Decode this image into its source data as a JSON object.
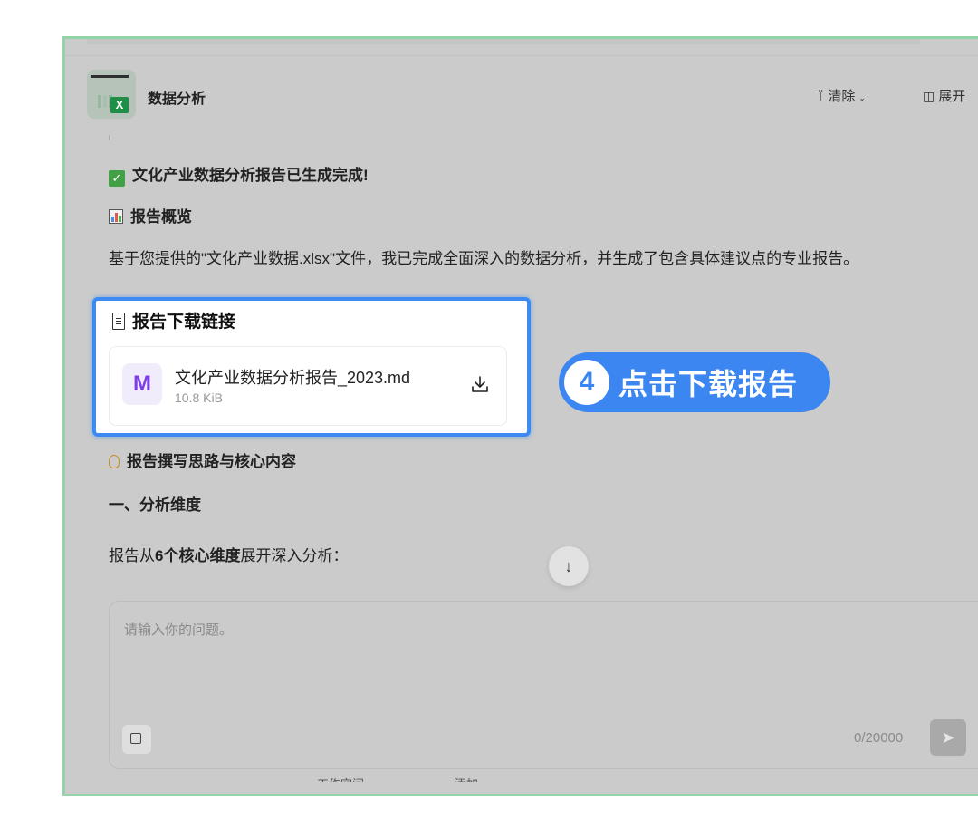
{
  "header": {
    "app_title": "数据分析",
    "clear_label": "清除",
    "expand_label": "展开"
  },
  "chat": {
    "done_title": "文化产业数据分析报告已生成完成!",
    "overview_title": "报告概览",
    "overview_text": "基于您提供的\"文化产业数据.xlsx\"文件，我已完成全面深入的数据分析，并生成了包含具体建议点的专业报告。",
    "download_title": "报告下载链接",
    "file": {
      "icon_letter": "M",
      "name": "文化产业数据分析报告_2023.md",
      "size": "10.8 KiB"
    },
    "idea_title": "报告撰写思路与核心内容",
    "dimension_title": "一、分析维度",
    "dimension_text_pre": "报告从",
    "dimension_text_bold": "6个核心维度",
    "dimension_text_post": "展开深入分析："
  },
  "callout": {
    "step_number": "4",
    "text": "点击下载报告",
    "color": "#3b86f0"
  },
  "input": {
    "placeholder": "请输入你的问题。",
    "char_count": "0/20000"
  },
  "footer": {
    "cut_left": "工作空间",
    "cut_right": "添加"
  },
  "colors": {
    "frame_border": "#93d3a8",
    "overlay": "#cbcbcb",
    "highlight": "#3d8bf2"
  }
}
